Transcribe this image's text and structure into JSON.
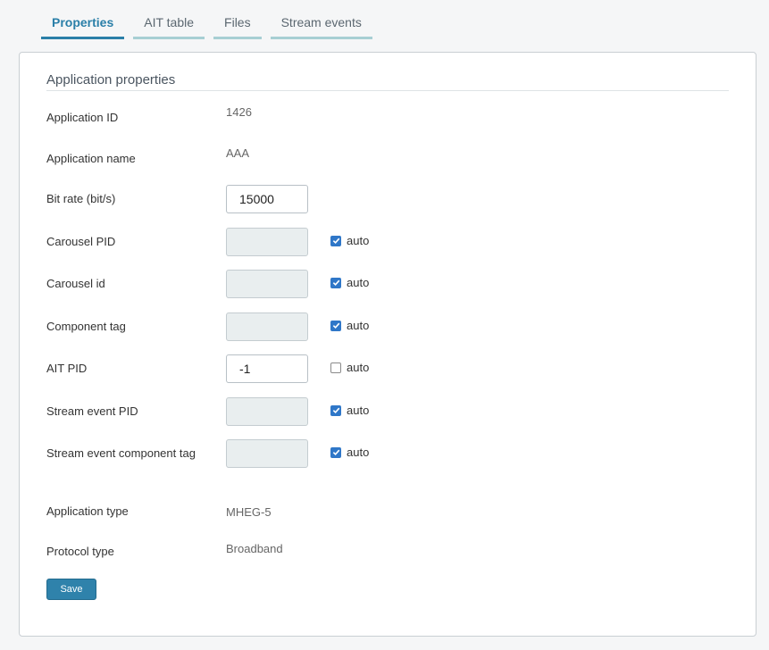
{
  "tabs": [
    {
      "label": "Properties",
      "active": true
    },
    {
      "label": "AIT table",
      "active": false
    },
    {
      "label": "Files",
      "active": false
    },
    {
      "label": "Stream events",
      "active": false
    }
  ],
  "section_title": "Application properties",
  "fields": {
    "application_id": {
      "label": "Application ID",
      "value": "1426"
    },
    "application_name": {
      "label": "Application name",
      "value": "AAA"
    },
    "bit_rate": {
      "label": "Bit rate (bit/s)",
      "value": "15000"
    },
    "carousel_pid": {
      "label": "Carousel PID",
      "value": "",
      "auto": true
    },
    "carousel_id": {
      "label": "Carousel id",
      "value": "",
      "auto": true
    },
    "component_tag": {
      "label": "Component tag",
      "value": "",
      "auto": true
    },
    "ait_pid": {
      "label": "AIT PID",
      "value": "-1",
      "auto": false
    },
    "stream_event_pid": {
      "label": "Stream event PID",
      "value": "",
      "auto": true
    },
    "stream_event_component_tag": {
      "label": "Stream event component tag",
      "value": "",
      "auto": true
    },
    "application_type": {
      "label": "Application type",
      "value": "MHEG-5"
    },
    "protocol_type": {
      "label": "Protocol type",
      "value": "Broadband"
    }
  },
  "auto_label": "auto",
  "save_label": "Save",
  "colors": {
    "accent": "#2a7fa8",
    "checkbox": "#2f77c8",
    "disabled_input": "#e9eeef"
  }
}
